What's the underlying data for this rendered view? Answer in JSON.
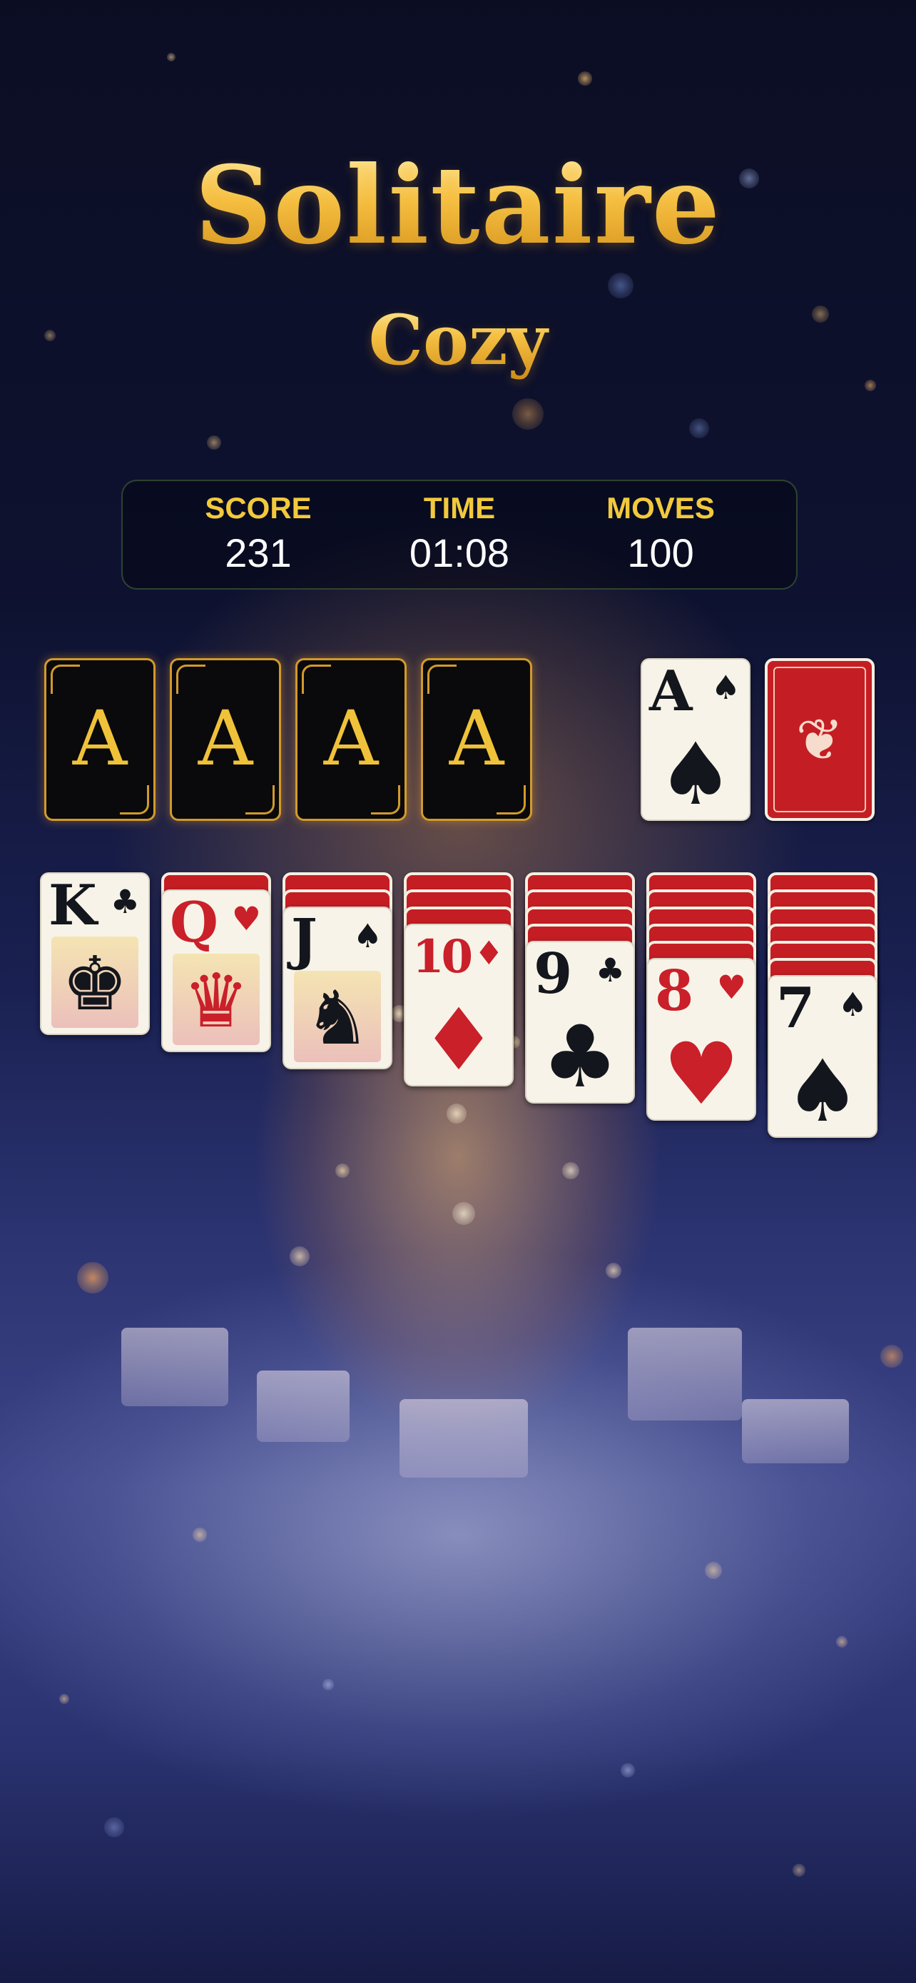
{
  "app": {
    "title": "Solitaire",
    "subtitle": "Cozy"
  },
  "stats": {
    "score": {
      "label": "SCORE",
      "value": "231"
    },
    "time": {
      "label": "TIME",
      "value": "01:08"
    },
    "moves": {
      "label": "MOVES",
      "value": "100"
    }
  },
  "foundations": [
    {
      "letter": "A"
    },
    {
      "letter": "A"
    },
    {
      "letter": "A"
    },
    {
      "letter": "A"
    }
  ],
  "waste": {
    "rank": "A",
    "suit": "♠",
    "color": "black"
  },
  "stock": {
    "emblem": "❦"
  },
  "tableau": [
    {
      "hidden": 0,
      "rank": "K",
      "suit": "♣",
      "color": "black",
      "face": "♚"
    },
    {
      "hidden": 1,
      "rank": "Q",
      "suit": "♥",
      "color": "red",
      "face": "♛"
    },
    {
      "hidden": 2,
      "rank": "J",
      "suit": "♠",
      "color": "black",
      "face": "♞"
    },
    {
      "hidden": 3,
      "rank": "10",
      "suit": "♦",
      "color": "red"
    },
    {
      "hidden": 4,
      "rank": "9",
      "suit": "♣",
      "color": "black"
    },
    {
      "hidden": 5,
      "rank": "8",
      "suit": "♥",
      "color": "red"
    },
    {
      "hidden": 6,
      "rank": "7",
      "suit": "♠",
      "color": "black"
    }
  ],
  "colors": {
    "gold": "#f2c93c",
    "card_back": "#c41e24",
    "card_face": "#f7f3e8"
  }
}
